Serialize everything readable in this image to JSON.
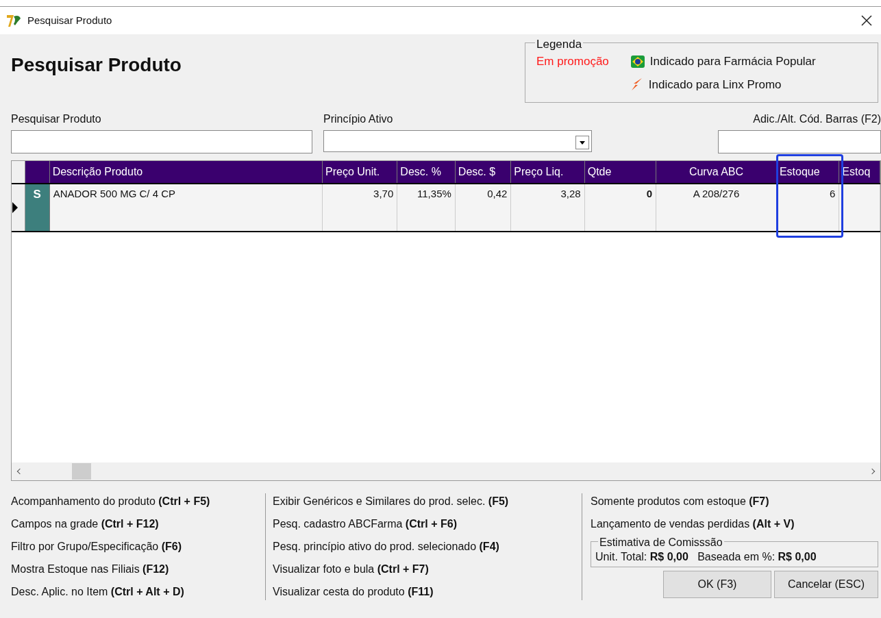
{
  "window": {
    "title": "Pesquisar Produto"
  },
  "heading": "Pesquisar Produto",
  "legend": {
    "title": "Legenda",
    "promo": "Em promoção",
    "items": [
      {
        "kind": "flag",
        "label": "Indicado para Farmácia Popular"
      },
      {
        "kind": "bolt",
        "label": "Indicado para Linx Promo"
      }
    ]
  },
  "fields": [
    {
      "kind": "text",
      "label": "Pesquisar Produto"
    },
    {
      "kind": "combo",
      "label": "Princípio Ativo"
    },
    {
      "kind": "text",
      "label": "Adic./Alt. Cód. Barras (F2)"
    }
  ],
  "table": {
    "columns": [
      {
        "label": "Descrição Produto",
        "highlighted": false
      },
      {
        "label": "Preço Unit.",
        "highlighted": false
      },
      {
        "label": "Desc. %",
        "highlighted": false
      },
      {
        "label": "Desc. $",
        "highlighted": false
      },
      {
        "label": "Preço Liq.",
        "highlighted": false
      },
      {
        "label": "Qtde",
        "highlighted": false
      },
      {
        "label": "Curva ABC",
        "highlighted": false
      },
      {
        "label": "Estoque",
        "highlighted": true
      },
      {
        "label": "Estoq",
        "highlighted": false
      }
    ],
    "rows": [
      {
        "selected": true,
        "tag": "S",
        "cells": [
          "ANADOR 500 MG C/ 4 CP",
          "3,70",
          "11,35%",
          "0,42",
          "3,28",
          "0",
          "A 208/276",
          "6",
          ""
        ]
      }
    ]
  },
  "shortcuts": [
    [
      "Acompanhamento do produto **(Ctrl + F5)**",
      "Campos na grade **(Ctrl + F12)**",
      "Filtro por Grupo/Especificação **(F6)**",
      "Mostra Estoque nas Filiais **(F12)**",
      "Desc. Aplic. no Item **(Ctrl + Alt + D)**"
    ],
    [
      "Exibir Genéricos e Similares do prod. selec. **(F5)**",
      "Pesq. cadastro ABCFarma **(Ctrl + F6)**",
      "Pesq. princípio ativo do prod. selecionado **(F4)**",
      "Visualizar foto e bula **(Ctrl + F7)**",
      "Visualizar cesta do produto **(F11)**"
    ],
    [
      "Somente produtos com estoque **(F7)**",
      "Lançamento de vendas perdidas **(Alt + V)**"
    ]
  ],
  "commission": {
    "title": "Estimativa de Comisssão",
    "text": "Unit. Total: **R$ 0,00**   Baseada em %: **R$ 0,00**"
  },
  "buttons": [
    "OK (F3)",
    "Cancelar (ESC)"
  ]
}
